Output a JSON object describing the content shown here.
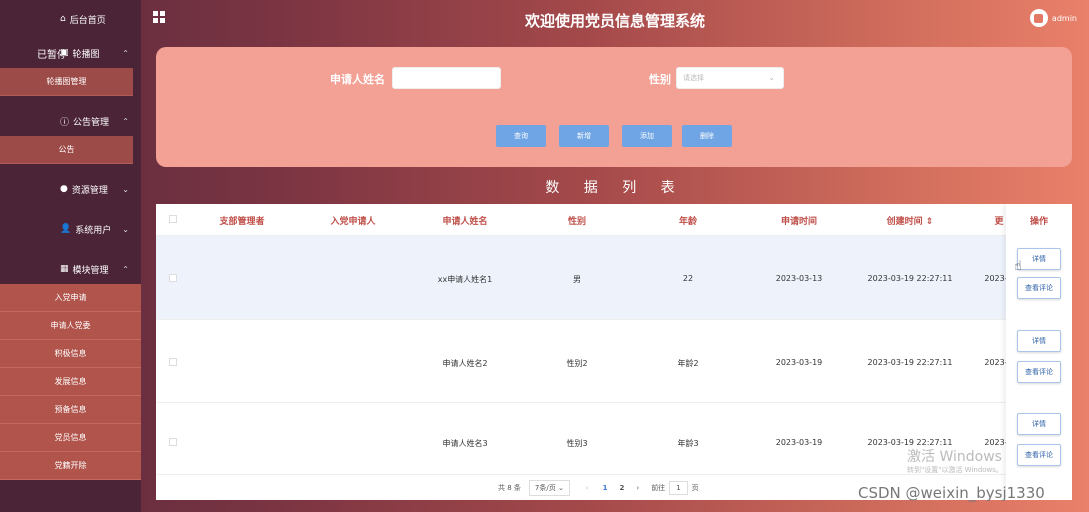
{
  "header": {
    "title": "欢迎使用党员信息管理系统",
    "user": "admin"
  },
  "sidebar": {
    "home": "后台首页",
    "paused": "已暂停",
    "carousel_group": "轮播图",
    "carousel_sub": "轮播图管理",
    "notice_group": "公告管理",
    "notice_sub": "公告",
    "resource_group": "资源管理",
    "system_group": "系统用户",
    "module_group": "模块管理",
    "module_items": [
      "入党申请",
      "申请人党委",
      "积极信息",
      "发展信息",
      "预备信息",
      "党员信息",
      "党籍开除"
    ]
  },
  "search": {
    "name_label": "申请人姓名",
    "name_value": "",
    "gender_label": "性别",
    "gender_placeholder": "请选择",
    "buttons": [
      "查询",
      "新增",
      "添加",
      "删除"
    ]
  },
  "list_title": "数 据 列 表",
  "table": {
    "columns": [
      "支部管理者",
      "入党申请人",
      "申请人姓名",
      "性别",
      "年龄",
      "申请时间",
      "创建时间 ⇕",
      "更",
      "操作"
    ],
    "rows": [
      {
        "name": "xx申请人姓名1",
        "gender": "男",
        "age": "22",
        "apply_time": "2023-03-13",
        "created": "2023-03-19 22:27:11",
        "more": "2023-"
      },
      {
        "name": "申请人姓名2",
        "gender": "性别2",
        "age": "年龄2",
        "apply_time": "2023-03-19",
        "created": "2023-03-19 22:27:11",
        "more": "2023-"
      },
      {
        "name": "申请人姓名3",
        "gender": "性别3",
        "age": "年龄3",
        "apply_time": "2023-03-19",
        "created": "2023-03-19 22:27:11",
        "more": "2023-"
      }
    ],
    "detail_label": "详情",
    "comment_label": "查看评论"
  },
  "pager": {
    "total": "共 8 条",
    "page_size": "7条/页 ⌄",
    "prev": "‹",
    "pages": [
      "1",
      "2"
    ],
    "next": "›",
    "goto_label": "前往",
    "goto_value": "1",
    "page_unit": "页"
  },
  "watermark": {
    "line1": "激活 Windows",
    "line2": "转到\"设置\"以激活 Windows。",
    "csdn": "CSDN @weixin_bysj1330"
  }
}
